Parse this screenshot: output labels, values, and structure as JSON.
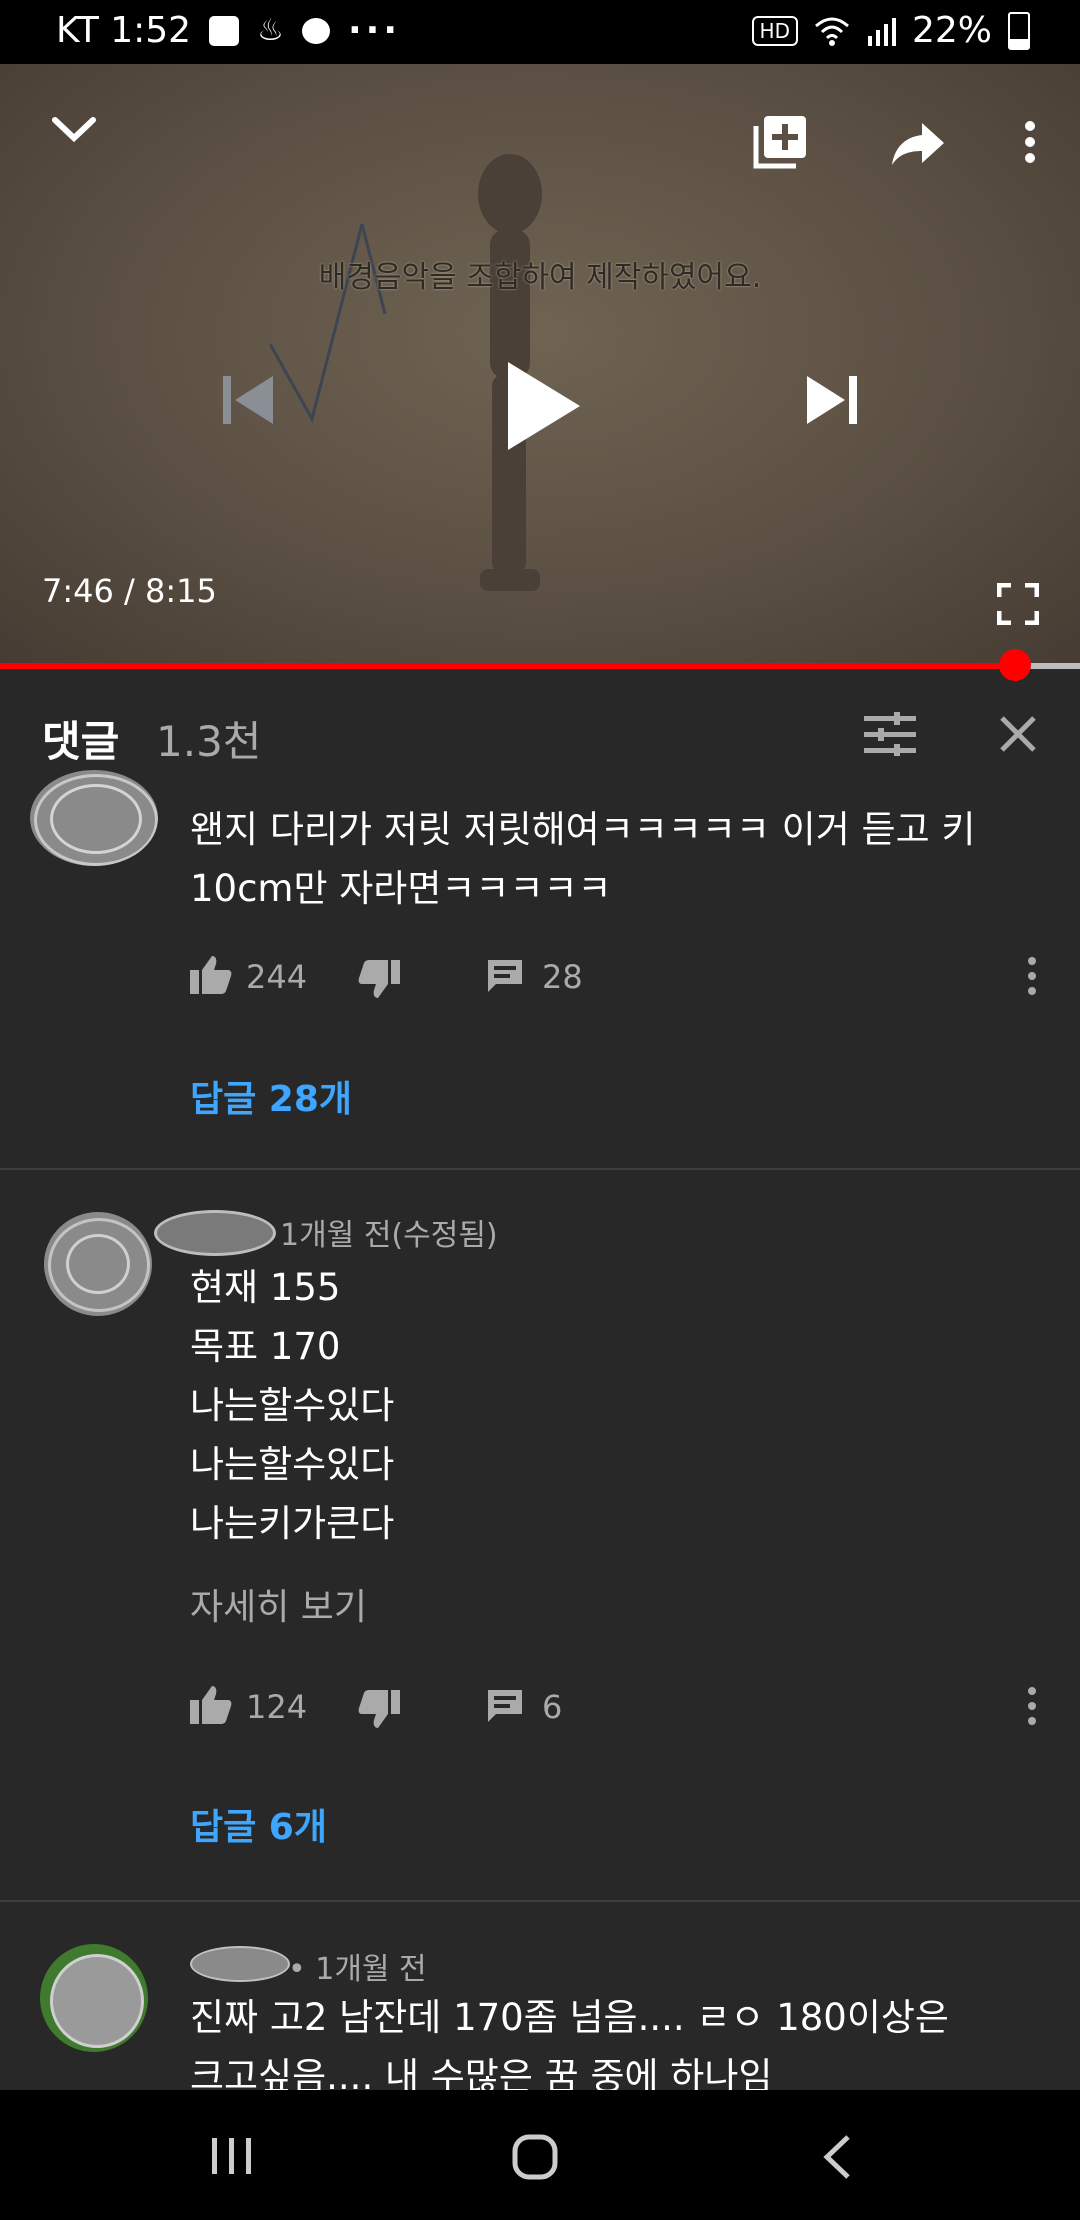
{
  "status_bar": {
    "carrier_time": "KT 1:52",
    "overflow": "···",
    "hd": "HD",
    "battery": "22%"
  },
  "player": {
    "caption": "배경음악을 조합하여 제작하였어요.",
    "time_current": "7:46",
    "time_separator": " / ",
    "time_total": "8:15",
    "progress_fraction": 0.94
  },
  "comments": {
    "title": "댓글",
    "count": "1.3천",
    "items": [
      {
        "meta": "",
        "lines": [
          "왠지 다리가 저릿 저릿해여ㅋㅋㅋㅋㅋ 이거 듣고 키",
          "10cm만 자라면ㅋㅋㅋㅋㅋ"
        ],
        "likes": "244",
        "reply_count": "28",
        "replies_link": "답글 28개"
      },
      {
        "meta": "1개월 전(수정됨)",
        "lines": [
          "현재 155",
          "목표 170",
          "나는할수있다",
          "나는할수있다",
          "나는키가큰다"
        ],
        "read_more": "자세히 보기",
        "likes": "124",
        "reply_count": "6",
        "replies_link": "답글 6개"
      },
      {
        "meta": "• 1개월 전",
        "lines": [
          "진짜 고2 남잔데 170좀 넘음.... ㄹㅇ 180이상은",
          "크고싶음.... 내 수많은 꿈 중에 하나임"
        ]
      }
    ]
  },
  "colors": {
    "background": "#282828",
    "progress": "#ff0000",
    "link": "#3ea6ff",
    "secondary_text": "#aaaaaa"
  }
}
